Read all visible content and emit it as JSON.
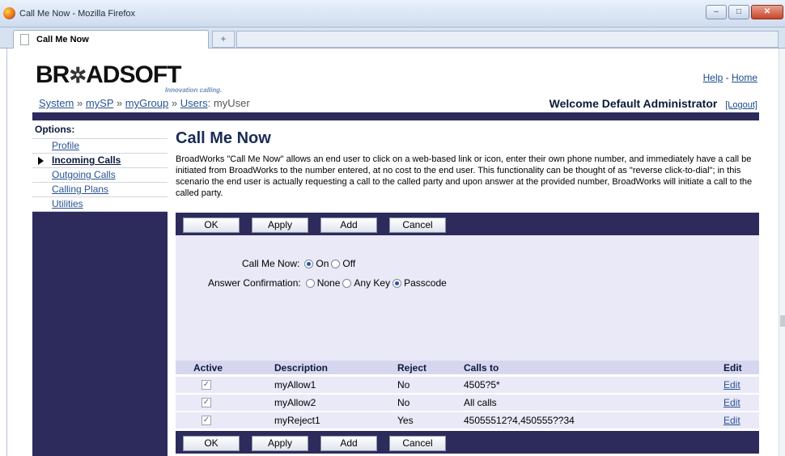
{
  "browser": {
    "window_title": "Call Me Now - Mozilla Firefox",
    "tab_label": "Call Me Now",
    "new_tab": "+",
    "win_minimize": "–",
    "win_maximize": "□",
    "win_close": "✕"
  },
  "header": {
    "logo_left": "BR",
    "logo_star": "✲",
    "logo_right": "ADSOFT",
    "tagline": "Innovation calling.",
    "help": "Help",
    "separator": "-",
    "home": "Home",
    "breadcrumb": {
      "system": "System",
      "mysp": "mySP",
      "mygroup": "myGroup",
      "users": "Users",
      "current": "myUser",
      "sep": "»",
      "sep_last": ":"
    },
    "welcome": "Welcome Default Administrator",
    "logout": "[Logout]"
  },
  "sidebar": {
    "title": "Options:",
    "items": [
      {
        "label": "Profile"
      },
      {
        "label": "Incoming Calls"
      },
      {
        "label": "Outgoing Calls"
      },
      {
        "label": "Calling Plans"
      },
      {
        "label": "Utilities"
      }
    ]
  },
  "main": {
    "title": "Call Me Now",
    "description": "BroadWorks \"Call Me Now\" allows an end user to click on a web-based link or icon, enter their own phone number, and immediately have a call be initiated from BroadWorks to the number entered, at no cost to the end user. This functionality can be thought of as \"reverse click-to-dial\"; in this scenario the end user is actually requesting a call to the called party and upon answer at the provided number, BroadWorks will initiate a call to the called party.",
    "buttons": {
      "ok": "OK",
      "apply": "Apply",
      "add": "Add",
      "cancel": "Cancel"
    },
    "call_me_now": {
      "label": "Call Me Now:",
      "on": "On",
      "off": "Off",
      "selected": "On"
    },
    "answer_confirmation": {
      "label": "Answer Confirmation:",
      "none": "None",
      "any_key": "Any Key",
      "passcode": "Passcode",
      "selected": "Passcode"
    },
    "table": {
      "headers": {
        "active": "Active",
        "description": "Description",
        "reject": "Reject",
        "calls_to": "Calls to",
        "edit": "Edit"
      },
      "rows": [
        {
          "active": true,
          "description": "myAllow1",
          "reject": "No",
          "calls_to": "4505?5*",
          "edit": "Edit"
        },
        {
          "active": true,
          "description": "myAllow2",
          "reject": "No",
          "calls_to": "All calls",
          "edit": "Edit"
        },
        {
          "active": true,
          "description": "myReject1",
          "reject": "Yes",
          "calls_to": "45055512?4,450555??34",
          "edit": "Edit"
        }
      ]
    }
  }
}
